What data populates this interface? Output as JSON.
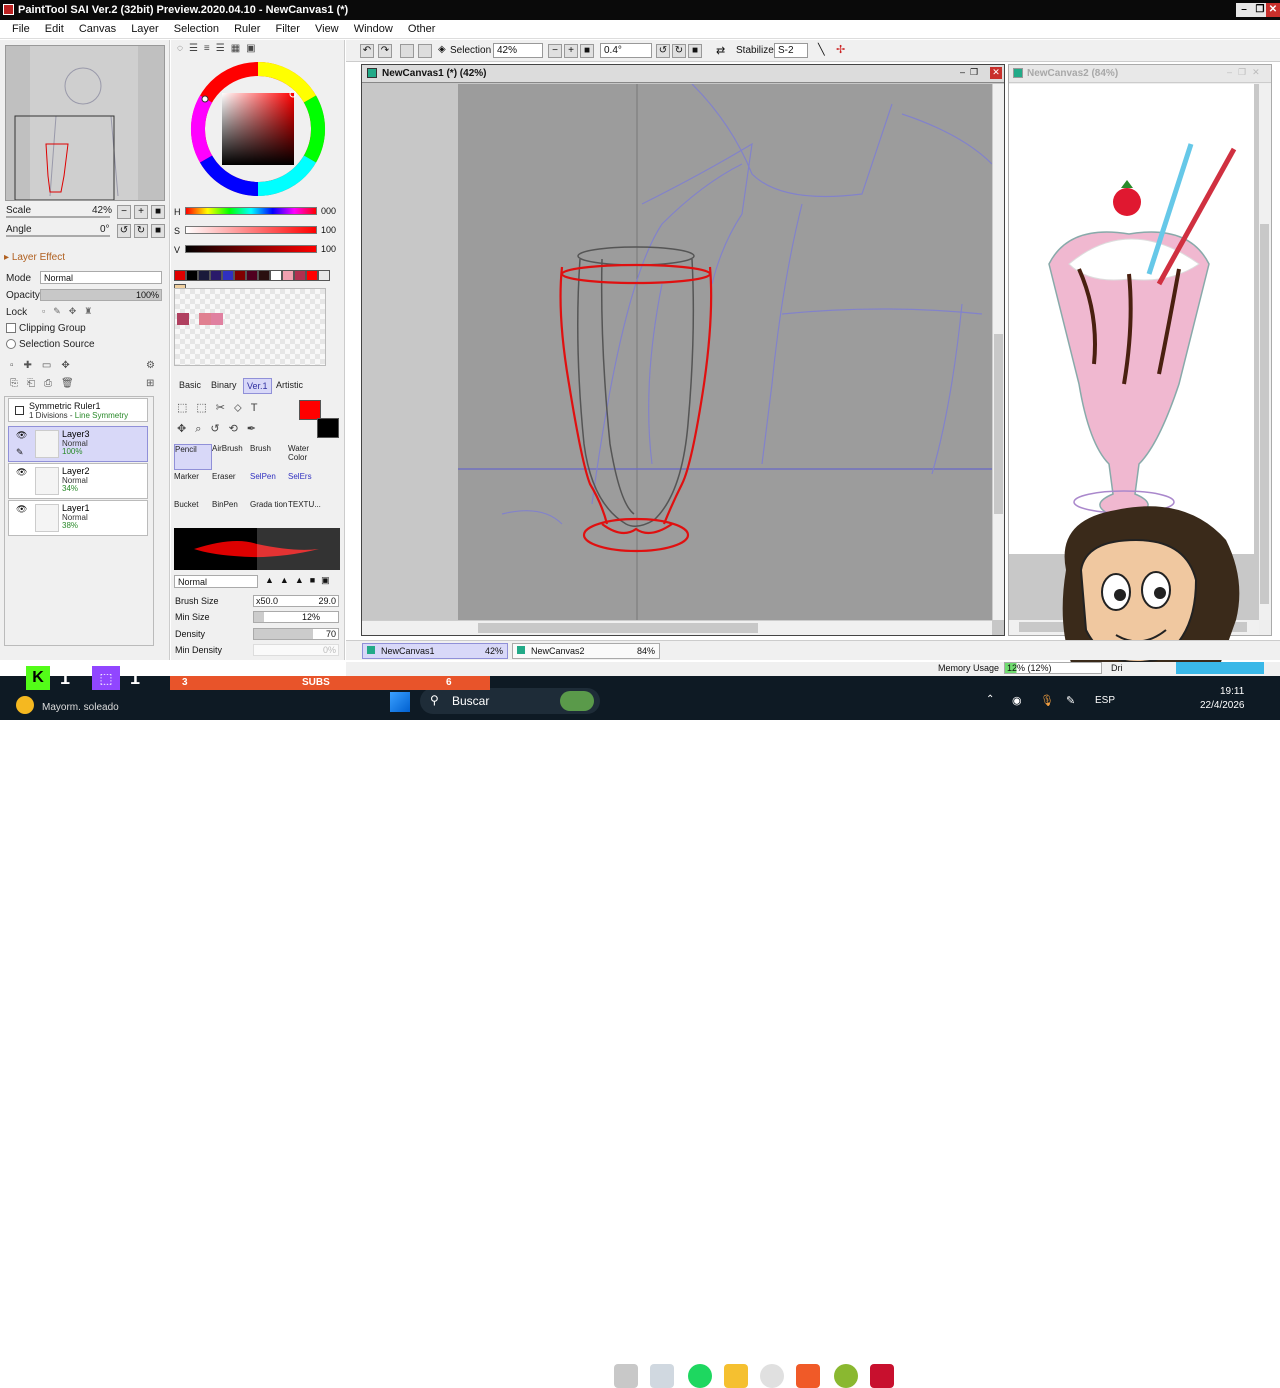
{
  "window": {
    "title": "PaintTool SAI Ver.2 (32bit) Preview.2020.04.10 - NewCanvas1 (*)"
  },
  "menu": [
    "File",
    "Edit",
    "Canvas",
    "Layer",
    "Selection",
    "Ruler",
    "Filter",
    "View",
    "Window",
    "Other"
  ],
  "toolbar": {
    "selection_label": "Selection",
    "zoom_value": "42%",
    "angle_value": "0.4°",
    "stabilizer_label": "Stabilizer",
    "stabilizer_value": "S-2"
  },
  "navigator": {
    "scale_label": "Scale",
    "scale_value": "42%",
    "angle_label": "Angle",
    "angle_value": "0°"
  },
  "layer_panel": {
    "effect_label": "Layer Effect",
    "mode_label": "Mode",
    "mode_value": "Normal",
    "opacity_label": "Opacity",
    "opacity_value": "100%",
    "lock_label": "Lock",
    "clipping_label": "Clipping Group",
    "selection_source_label": "Selection Source",
    "ruler": {
      "name": "Symmetric Ruler1",
      "detail_a": "1 Divisions - ",
      "detail_b": "Line Symmetry"
    },
    "layers": [
      {
        "name": "Layer3",
        "mode": "Normal",
        "opacity": "100%"
      },
      {
        "name": "Layer2",
        "mode": "Normal",
        "opacity": "34%"
      },
      {
        "name": "Layer1",
        "mode": "Normal",
        "opacity": "38%"
      }
    ]
  },
  "color_panel": {
    "h_label": "H",
    "h_value": "000",
    "s_label": "S",
    "s_value": "100",
    "v_label": "V",
    "v_value": "100",
    "swatches": [
      "#e00000",
      "#000000",
      "#1a1a3a",
      "#2a1a6a",
      "#3030c0",
      "#800000",
      "#500020",
      "#2a1010",
      "#ffffff",
      "#f0a0b0",
      "#b03050",
      "#ff0000",
      "#e8e8e8",
      "#f0d0a0"
    ],
    "scratch_colors": [
      "#b04060",
      "#e08090",
      "#e080a0"
    ]
  },
  "tools": {
    "tabs": [
      "Basic",
      "Binary",
      "Ver.1",
      "Artistic"
    ],
    "active_tab": "Ver.1",
    "brushes": [
      [
        "Pencil",
        "AirBrush",
        "Brush",
        "Water Color"
      ],
      [
        "Marker",
        "Eraser",
        "SelPen",
        "SelErs"
      ],
      [
        "Bucket",
        "BinPen",
        "Grada tion",
        "TEXTU..."
      ]
    ],
    "blend_mode": "Normal",
    "brush_size_label": "Brush Size",
    "brush_size_mult": "x50.0",
    "brush_size_value": "29.0",
    "min_size_label": "Min Size",
    "min_size_value": "12%",
    "density_label": "Density",
    "density_value": "70",
    "min_density_label": "Min Density",
    "min_density_value": "0%"
  },
  "canvases": [
    {
      "title": "NewCanvas1 (*) (42%)"
    },
    {
      "title": "NewCanvas2 (84%)"
    }
  ],
  "canvas_tabs": [
    {
      "name": "NewCanvas1",
      "zoom": "42%"
    },
    {
      "name": "NewCanvas2",
      "zoom": "84%"
    }
  ],
  "status": {
    "memory_label": "Memory Usage",
    "memory_value": "12% (12%)",
    "drive_label": "Dri"
  },
  "overlay": {
    "subs_left": "3",
    "subs_label": "SUBS",
    "subs_right": "6",
    "kick_count": "1",
    "twitch_count": "1"
  },
  "taskbar": {
    "weather": "Mayorm. soleado",
    "search": "Buscar",
    "lang": "ESP",
    "time": "19:11",
    "date": "22/4/2026"
  }
}
